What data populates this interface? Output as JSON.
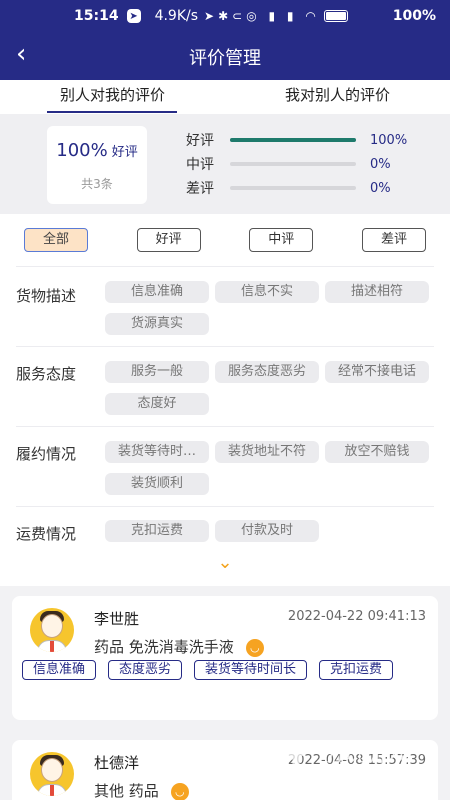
{
  "status_bar": {
    "time": "15:14",
    "speed": "4.9K/s",
    "battery": "100%"
  },
  "header": {
    "title": "评价管理"
  },
  "tabs": [
    {
      "label": "别人对我的评价",
      "active": true
    },
    {
      "label": "我对别人的评价",
      "active": false
    }
  ],
  "summary": {
    "good_rate": "100%",
    "good_rate_label": "好评",
    "total": "共3条",
    "rows": [
      {
        "label": "好评",
        "value": "100%",
        "fraction": 1.0
      },
      {
        "label": "中评",
        "value": "0%",
        "fraction": 0.0
      },
      {
        "label": "差评",
        "value": "0%",
        "fraction": 0.0
      }
    ]
  },
  "filters": [
    {
      "label": "全部",
      "selected": true
    },
    {
      "label": "好评",
      "selected": false
    },
    {
      "label": "中评",
      "selected": false
    },
    {
      "label": "差评",
      "selected": false
    }
  ],
  "categories": [
    {
      "label": "货物描述",
      "chips": [
        "信息准确",
        "信息不实",
        "描述相符",
        "货源真实"
      ]
    },
    {
      "label": "服务态度",
      "chips": [
        "服务一般",
        "服务态度恶劣",
        "经常不接电话",
        "态度好"
      ]
    },
    {
      "label": "履约情况",
      "chips": [
        "装货等待时…",
        "装货地址不符",
        "放空不赔钱",
        "装货顺利"
      ]
    },
    {
      "label": "运费情况",
      "chips": [
        "克扣运费",
        "付款及时"
      ]
    }
  ],
  "reviews": [
    {
      "name": "李世胜",
      "time": "2022-04-22 09:41:13",
      "goods": "药品 免洗消毒洗手液",
      "tags": [
        "信息准确",
        "态度恶劣",
        "装货等待时间长",
        "克扣运费"
      ]
    },
    {
      "name": "杜德洋",
      "time": "2022-04-08 15:57:39",
      "goods": "其他 药品",
      "tags": []
    }
  ],
  "watermark": {
    "brand": "仍玩游戏",
    "sub": "Rengwan Games"
  },
  "colors": {
    "primary": "#262b86",
    "accent_orange": "#f3a21b",
    "good_bar": "#1e7a6c"
  }
}
